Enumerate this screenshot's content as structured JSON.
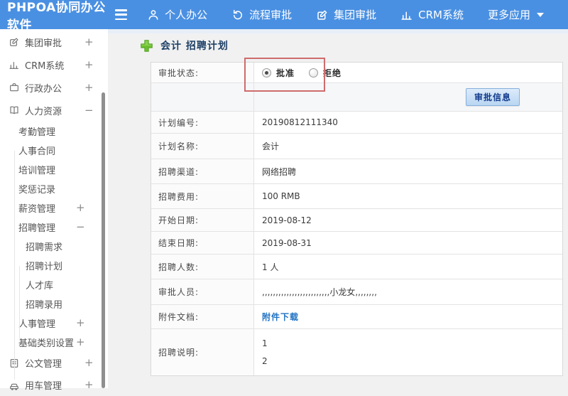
{
  "colors": {
    "topbar": "#4a90e2",
    "red": "#cf6b6b",
    "green": "#62b82e",
    "link": "#2173c4",
    "btntext": "#123a8c",
    "title": "#1e4066"
  },
  "topbar": {
    "logo": "PHPOA协同办公软件",
    "items": [
      {
        "label": "个人办公",
        "icon": "user-icon"
      },
      {
        "label": "流程审批",
        "icon": "cycle-icon"
      },
      {
        "label": "集团审批",
        "icon": "edit-square-icon"
      },
      {
        "label": "CRM系统",
        "icon": "bar-chart-icon"
      },
      {
        "label": "更多应用",
        "icon": "caret-down-icon"
      }
    ]
  },
  "sidebar": {
    "items": [
      {
        "label": "集团审批",
        "icon": "edit-square-icon",
        "expander": "+",
        "level": 1
      },
      {
        "label": "CRM系统",
        "icon": "bar-chart-icon",
        "expander": "+",
        "level": 1
      },
      {
        "label": "行政办公",
        "icon": "briefcase-icon",
        "expander": "+",
        "level": 1
      },
      {
        "label": "人力资源",
        "icon": "book-icon",
        "expander": "−",
        "level": 1
      },
      {
        "label": "考勤管理",
        "level": 2
      },
      {
        "label": "人事合同",
        "level": 2
      },
      {
        "label": "培训管理",
        "level": 2
      },
      {
        "label": "奖惩记录",
        "level": 2
      },
      {
        "label": "薪资管理",
        "expander": "+",
        "level": 2
      },
      {
        "label": "招聘管理",
        "expander": "−",
        "level": 2
      },
      {
        "label": "招聘需求",
        "level": 3
      },
      {
        "label": "招聘计划",
        "level": 3
      },
      {
        "label": "人才库",
        "level": 3
      },
      {
        "label": "招聘录用",
        "level": 3
      },
      {
        "label": "人事管理",
        "expander": "+",
        "level": 2
      },
      {
        "label": "基础类别设置",
        "expander": "+",
        "level": 2
      },
      {
        "label": "公文管理",
        "icon": "document-icon",
        "expander": "+",
        "level": 1
      },
      {
        "label": "用车管理",
        "icon": "car-icon",
        "expander": "+",
        "level": 1
      }
    ]
  },
  "main": {
    "title": "会计 招聘计划",
    "approval": {
      "status_label": "审批状态:",
      "options": [
        {
          "label": "批准",
          "checked": true
        },
        {
          "label": "拒绝",
          "checked": false
        }
      ],
      "info_button": "审批信息"
    },
    "fields": [
      {
        "label": "计划编号:",
        "value": "20190812111340"
      },
      {
        "label": "计划名称:",
        "value": "会计"
      },
      {
        "label": "招聘渠道:",
        "value": "网络招聘"
      },
      {
        "label": "招聘费用:",
        "value": "100 RMB"
      },
      {
        "label": "开始日期:",
        "value": "2019-08-12"
      },
      {
        "label": "结束日期:",
        "value": "2019-08-31"
      },
      {
        "label": "招聘人数:",
        "value": "1 人"
      },
      {
        "label": "审批人员:",
        "value": ",,,,,,,,,,,,,,,,,,,,,,,,,小龙女,,,,,,,,"
      },
      {
        "label": "附件文档:",
        "value": "附件下载",
        "type": "link"
      },
      {
        "label": "招聘说明:",
        "lines": [
          "1",
          "2"
        ]
      }
    ]
  }
}
